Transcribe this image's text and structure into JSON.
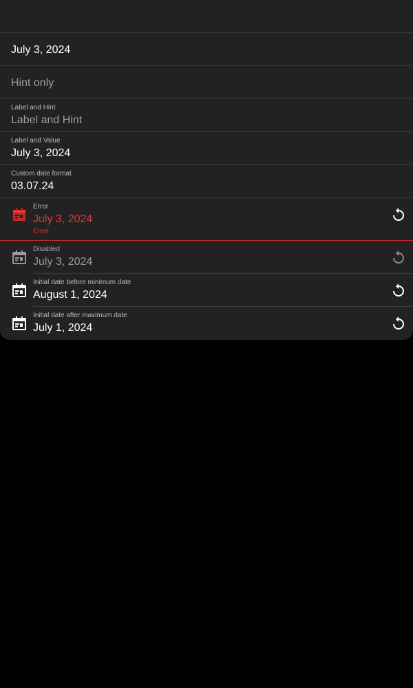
{
  "fields": [
    {
      "id": "top-empty"
    },
    {
      "id": "plain-value",
      "value": "July 3, 2024"
    },
    {
      "id": "hint-only",
      "hint": "Hint only"
    },
    {
      "id": "label-hint",
      "label": "Label and Hint",
      "hint": "Label and Hint"
    },
    {
      "id": "label-value",
      "label": "Label and Value",
      "value": "July 3, 2024"
    },
    {
      "id": "custom-format",
      "label": "Custom date format",
      "value": "03.07.24"
    },
    {
      "id": "error",
      "label": "Error",
      "value": "July 3, 2024",
      "helper": "Error"
    },
    {
      "id": "disabled",
      "label": "Disabled",
      "value": "July 3, 2024"
    },
    {
      "id": "before-min",
      "label": "Initial date before minimum date",
      "value": "August 1, 2024"
    },
    {
      "id": "after-max",
      "label": "Initial date after maximum date",
      "value": "July 1, 2024"
    }
  ],
  "colors": {
    "background": "#000000",
    "card": "#222222",
    "divider": "#3a3a3a",
    "error": "#e53935",
    "text": "#ffffff",
    "muted": "#9e9e9e"
  },
  "icons": {
    "calendar": "calendar-icon",
    "reset": "reset-icon"
  }
}
